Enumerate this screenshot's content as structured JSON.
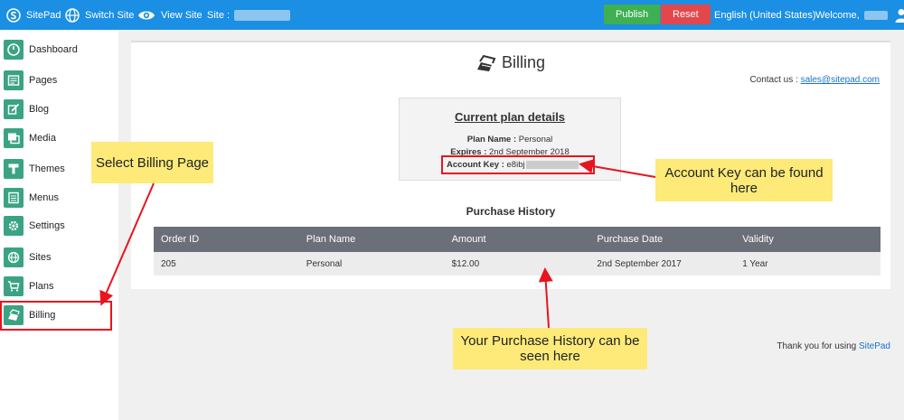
{
  "topbar": {
    "brand": "SitePad",
    "switch_site": "Switch Site",
    "view_site": "View Site",
    "site_label": "Site :",
    "publish": "Publish",
    "reset": "Reset",
    "language": "English (United States)",
    "welcome": "Welcome,",
    "colors": {
      "bar": "#1a8fe3",
      "publish": "#3fb052",
      "reset": "#e3474c"
    }
  },
  "sidebar": {
    "items": [
      {
        "label": "Dashboard",
        "icon": "dashboard-icon"
      },
      {
        "label": "Pages",
        "icon": "pages-icon"
      },
      {
        "label": "Blog",
        "icon": "blog-icon"
      },
      {
        "label": "Media",
        "icon": "media-icon"
      },
      {
        "label": "Themes",
        "icon": "themes-icon"
      },
      {
        "label": "Menus",
        "icon": "menus-icon"
      },
      {
        "label": "Settings",
        "icon": "settings-icon"
      },
      {
        "label": "Sites",
        "icon": "sites-icon"
      },
      {
        "label": "Plans",
        "icon": "plans-icon"
      },
      {
        "label": "Billing",
        "icon": "billing-icon"
      }
    ],
    "accent": "#3aa383"
  },
  "main": {
    "title": "Billing",
    "contact_label": "Contact us :",
    "contact_email": "sales@sitepad.com",
    "plan": {
      "heading": "Current plan details",
      "name_label": "Plan Name :",
      "name_value": "Personal",
      "expires_label": "Expires :",
      "expires_value": "2nd September 2018",
      "key_label": "Account Key :",
      "key_value": "e8ibj"
    },
    "purchase_history": {
      "title": "Purchase History",
      "columns": [
        "Order ID",
        "Plan Name",
        "Amount",
        "Purchase Date",
        "Validity"
      ],
      "rows": [
        [
          "205",
          "Personal",
          "$12.00",
          "2nd September 2017",
          "1 Year"
        ]
      ]
    },
    "thanks_text": "Thank you for using",
    "thanks_brand": "SitePad"
  },
  "annotations": {
    "select_billing": "Select Billing Page",
    "account_key": "Account Key can be found here",
    "purchase_history": "Your Purchase History can be seen here"
  }
}
